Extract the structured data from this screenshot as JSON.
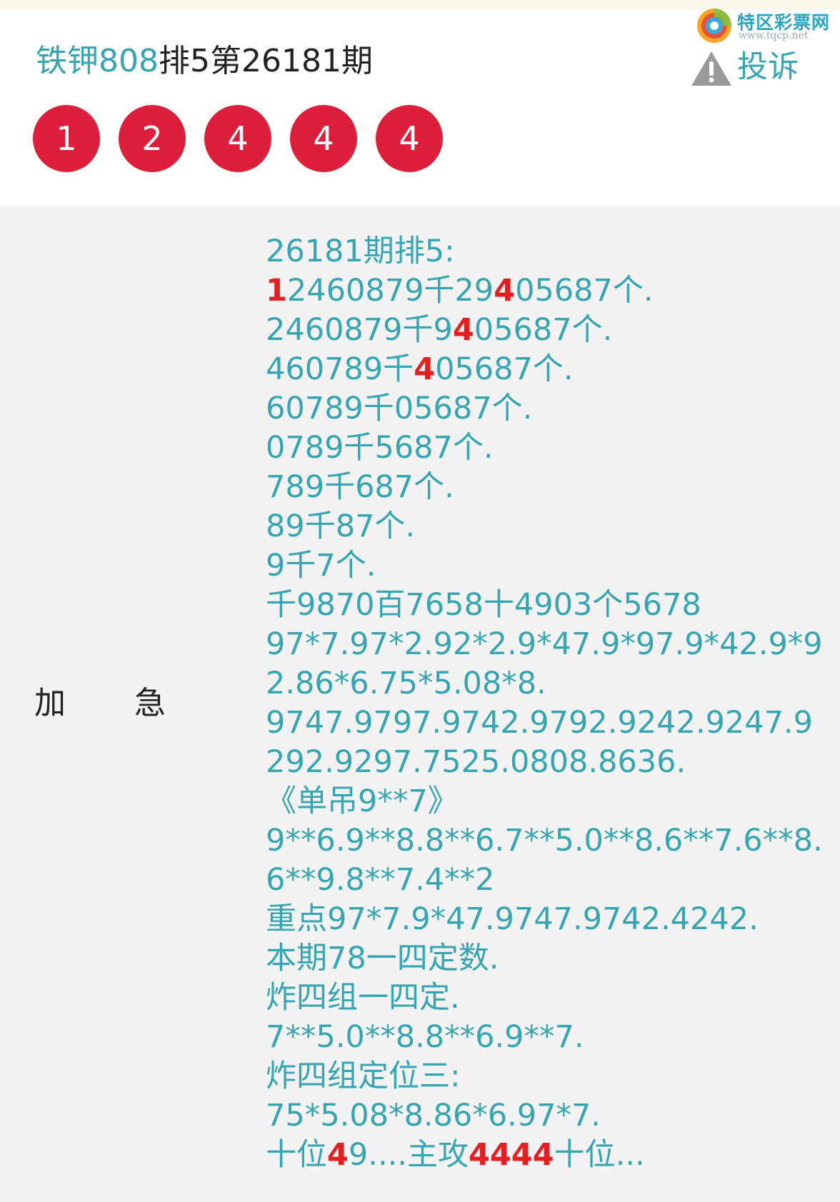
{
  "header": {
    "author": "铁钾808",
    "title_rest": "排5第26181期",
    "balls": [
      "1",
      "2",
      "4",
      "4",
      "4"
    ],
    "site_name": "特区彩票网",
    "site_url": "www.tqcp.net",
    "report_label": "投诉"
  },
  "row": {
    "label_1": "加",
    "label_2": "急"
  },
  "post": {
    "lines": [
      [
        {
          "t": "26181期排5:"
        }
      ],
      [
        {
          "t": "1",
          "hl": true
        },
        {
          "t": "2460879千29"
        },
        {
          "t": "4",
          "hl": true
        },
        {
          "t": "05687个."
        }
      ],
      [
        {
          "t": "2460879千9"
        },
        {
          "t": "4",
          "hl": true
        },
        {
          "t": "05687个."
        }
      ],
      [
        {
          "t": "460789千"
        },
        {
          "t": "4",
          "hl": true
        },
        {
          "t": "05687个."
        }
      ],
      [
        {
          "t": "60789千05687个."
        }
      ],
      [
        {
          "t": "0789千5687个."
        }
      ],
      [
        {
          "t": "789千687个."
        }
      ],
      [
        {
          "t": "89千87个."
        }
      ],
      [
        {
          "t": "9千7个."
        }
      ],
      [
        {
          "t": "千9870百7658十4903个5678"
        }
      ],
      [
        {
          "t": "97*7.97*2.92*2.9*47.9*97.9*42.9*9"
        }
      ],
      [
        {
          "t": "2.86*6.75*5.08*8."
        }
      ],
      [
        {
          "t": "9747.9797.9742.9792.9242.9247.9"
        }
      ],
      [
        {
          "t": "292.9297.7525.0808.8636."
        }
      ],
      [
        {
          "t": "《单吊9**7》"
        }
      ],
      [
        {
          "t": "9**6.9**8.8**6.7**5.0**8.6**7.6**8."
        }
      ],
      [
        {
          "t": "6**9.8**7.4**2"
        }
      ],
      [
        {
          "t": "重点97*7.9*47.9747.9742.4242."
        }
      ],
      [
        {
          "t": "本期78一四定数."
        }
      ],
      [
        {
          "t": "炸四组一四定."
        }
      ],
      [
        {
          "t": "7**5.0**8.8**6.9**7."
        }
      ],
      [
        {
          "t": "炸四组定位三:"
        }
      ],
      [
        {
          "t": "75*5.08*8.86*6.97*7."
        }
      ],
      [
        {
          "t": "十位"
        },
        {
          "t": "4",
          "hl": true
        },
        {
          "t": "9....主攻"
        },
        {
          "t": "4444",
          "hl": true
        },
        {
          "t": "十位..."
        }
      ]
    ]
  },
  "colors": {
    "accent": "#35a6b1",
    "ball": "#dd1f3b",
    "highlight": "#e41f1f",
    "background": "#f2f2f2"
  },
  "icons": {
    "site_logo": "swirl-logo-icon",
    "report": "warning-triangle-icon"
  }
}
